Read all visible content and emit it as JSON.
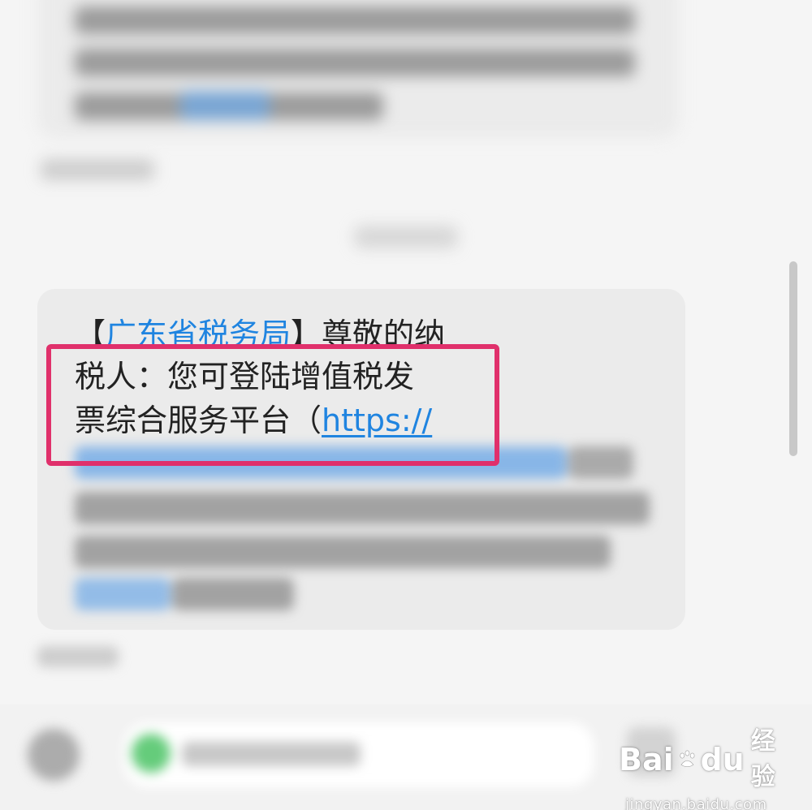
{
  "message": {
    "bracket_open": "【",
    "sender": "广东省税务局",
    "bracket_close": "】",
    "line1_rest": "尊敬的纳",
    "line2": "税人：您可登陆增值税发",
    "line3_text": "票综合服务平台（",
    "line3_link": "https://"
  },
  "watermark": {
    "brand_left": "Bai",
    "brand_right": "du",
    "brand_cn": "经验",
    "domain": "jingyan.baidu.com"
  },
  "colors": {
    "link": "#1f84e0",
    "highlight_border": "#e0306b",
    "bubble": "#ebebeb",
    "background": "#f5f5f5"
  },
  "icons": {
    "attach": "plus-circle-icon",
    "sim": "sim-card-icon",
    "send": "send-icon",
    "watermark_logo": "baidu-paw-icon"
  }
}
